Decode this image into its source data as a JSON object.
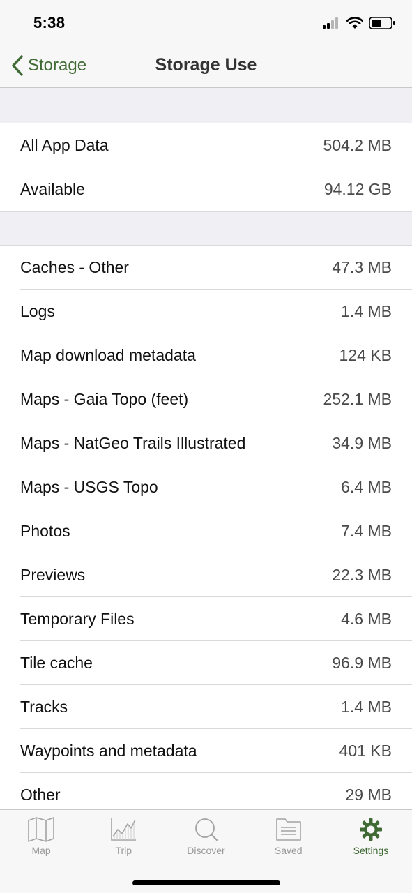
{
  "status_bar": {
    "time": "5:38"
  },
  "nav": {
    "back_label": "Storage",
    "title": "Storage Use"
  },
  "summary": [
    {
      "label": "All App Data",
      "value": "504.2 MB"
    },
    {
      "label": "Available",
      "value": "94.12 GB"
    }
  ],
  "details": [
    {
      "label": "Caches - Other",
      "value": "47.3 MB"
    },
    {
      "label": "Logs",
      "value": "1.4 MB"
    },
    {
      "label": "Map download metadata",
      "value": "124 KB"
    },
    {
      "label": "Maps - Gaia Topo (feet)",
      "value": "252.1 MB"
    },
    {
      "label": "Maps - NatGeo Trails Illustrated",
      "value": "34.9 MB"
    },
    {
      "label": "Maps - USGS Topo",
      "value": "6.4 MB"
    },
    {
      "label": "Photos",
      "value": "7.4 MB"
    },
    {
      "label": "Previews",
      "value": "22.3 MB"
    },
    {
      "label": "Temporary Files",
      "value": "4.6 MB"
    },
    {
      "label": "Tile cache",
      "value": "96.9 MB"
    },
    {
      "label": "Tracks",
      "value": "1.4 MB"
    },
    {
      "label": "Waypoints and metadata",
      "value": "401 KB"
    },
    {
      "label": "Other",
      "value": "29 MB"
    }
  ],
  "tab_bar": {
    "tabs": [
      {
        "label": "Map",
        "icon": "map-icon",
        "active": false
      },
      {
        "label": "Trip",
        "icon": "chart-icon",
        "active": false
      },
      {
        "label": "Discover",
        "icon": "search-icon",
        "active": false
      },
      {
        "label": "Saved",
        "icon": "folder-icon",
        "active": false
      },
      {
        "label": "Settings",
        "icon": "gear-icon",
        "active": true
      }
    ]
  },
  "colors": {
    "accent": "#3f6a34",
    "inactive": "#9a9a9a",
    "background": "#efeff4"
  }
}
